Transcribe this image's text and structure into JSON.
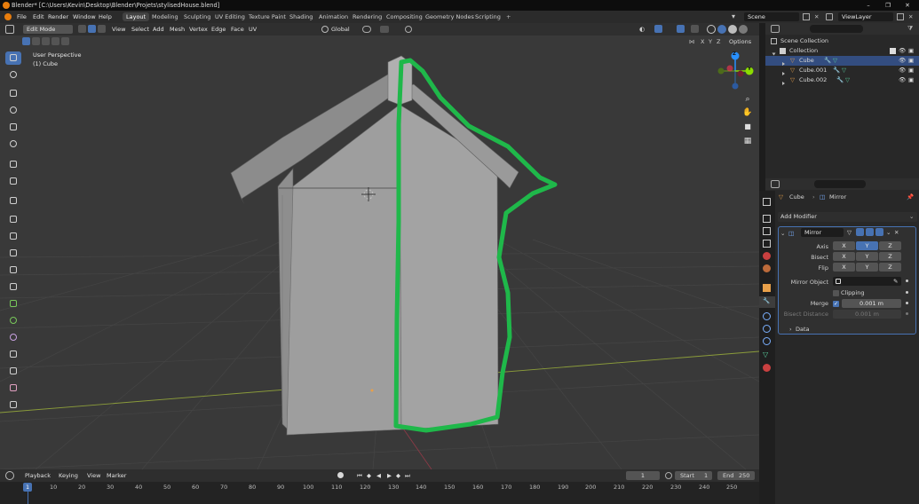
{
  "title_bar": {
    "title": "Blender* [C:\\Users\\Kevin\\Desktop\\Blender\\Projets\\stylisedHouse.blend]",
    "minimize": "–",
    "maximize": "❐",
    "close": "✕"
  },
  "menu": [
    "File",
    "Edit",
    "Render",
    "Window",
    "Help"
  ],
  "workspaces": [
    "Layout",
    "Modeling",
    "Sculpting",
    "UV Editing",
    "Texture Paint",
    "Shading",
    "Animation",
    "Rendering",
    "Compositing",
    "Geometry Nodes",
    "Scripting"
  ],
  "active_workspace": "Layout",
  "scene": "Scene",
  "view_layer": "ViewLayer",
  "viewport_header": {
    "mode": "Edit Mode",
    "menus": [
      "View",
      "Select",
      "Add",
      "Mesh",
      "Vertex",
      "Edge",
      "Face",
      "UV"
    ],
    "transform_orientation": "Global",
    "axes": [
      "X",
      "Y",
      "Z"
    ],
    "options": "Options"
  },
  "viewport": {
    "view_name": "User Perspective",
    "object_name": "(1) Cube",
    "gizmo": {
      "z": "Z",
      "y": "Y",
      "x": "X"
    }
  },
  "colors": {
    "accent_blue": "#4772b3",
    "x_axis": "#ff3352",
    "y_axis": "#8bdc00",
    "z_axis": "#2890ff",
    "annotation_green": "#1fb84a",
    "object_orange": "#e8a04a"
  },
  "tools": [
    "select-box",
    "cursor",
    "move",
    "rotate",
    "scale",
    "transform",
    "annotate",
    "measure",
    "add-cube",
    "extrude-region",
    "inset-faces",
    "bevel",
    "loop-cut",
    "knife",
    "poly-build",
    "spin",
    "smooth",
    "edge-slide",
    "shrink-fatten",
    "shear",
    "rip-region"
  ],
  "outliner": {
    "root": "Scene Collection",
    "collection": "Collection",
    "items": [
      "Cube",
      "Cube.001",
      "Cube.002"
    ],
    "selected": "Cube"
  },
  "properties": {
    "breadcrumb_object": "Cube",
    "breadcrumb_modifier": "Mirror",
    "add_modifier": "Add Modifier",
    "modifier_name": "Mirror",
    "rows": {
      "axis": "Axis",
      "bisect": "Bisect",
      "flip": "Flip"
    },
    "axis_labels": [
      "X",
      "Y",
      "Z"
    ],
    "axis_active": [
      "Y"
    ],
    "mirror_object_label": "Mirror Object",
    "clipping_label": "Clipping",
    "merge_label": "Merge",
    "merge_value": "0.001 m",
    "bisect_distance_label": "Bisect Distance",
    "bisect_distance_value": "0.001 m",
    "data_section": "Data"
  },
  "timeline": {
    "menus": [
      "Playback",
      "Keying",
      "View",
      "Marker"
    ],
    "current_frame": "1",
    "start_label": "Start",
    "start": "1",
    "end_label": "End",
    "end": "250",
    "ticks": [
      "1",
      "10",
      "20",
      "30",
      "40",
      "50",
      "60",
      "70",
      "80",
      "90",
      "100",
      "110",
      "120",
      "130",
      "140",
      "150",
      "160",
      "170",
      "180",
      "190",
      "200",
      "210",
      "220",
      "230",
      "240",
      "250"
    ]
  }
}
